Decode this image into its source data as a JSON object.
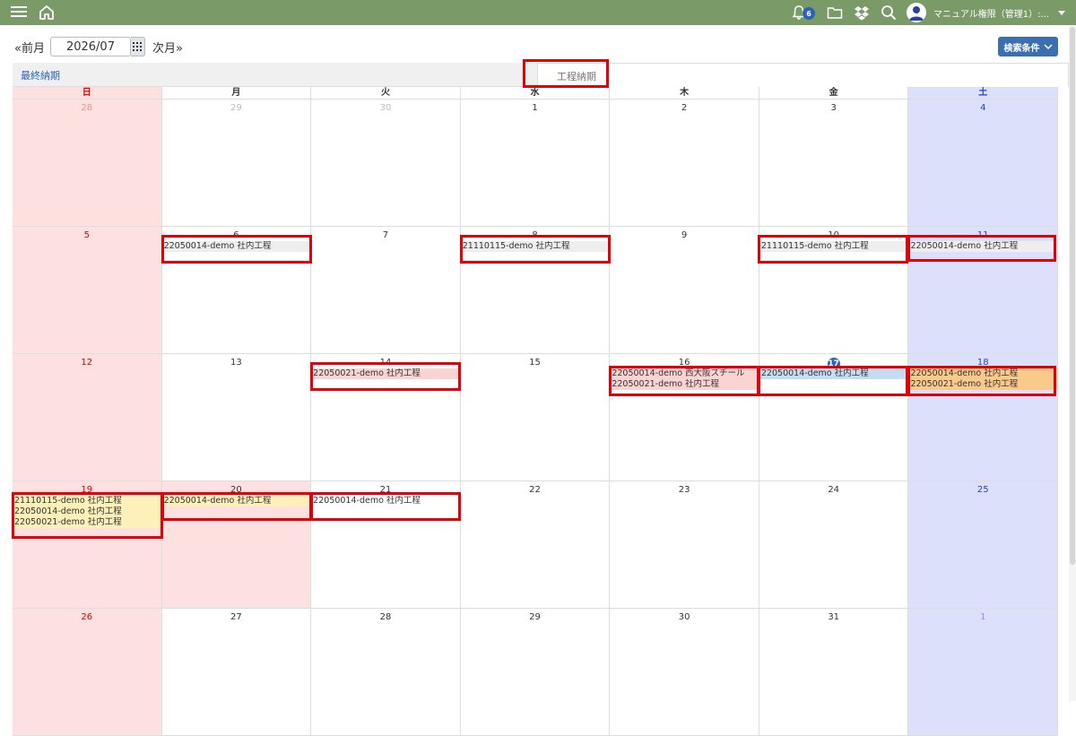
{
  "topbar": {
    "notification_count": "6",
    "user_name": "マニュアル権限（管理1）:...",
    "bar_color": "#7a9a68"
  },
  "nav": {
    "prev_label": "«前月",
    "month_value": "2026/07",
    "next_label": "次月»",
    "search_label": "検索条件"
  },
  "tabs": {
    "final_due": "最終納期",
    "process_due": "工程納期"
  },
  "weekdays": [
    "日",
    "月",
    "火",
    "水",
    "木",
    "金",
    "土"
  ],
  "weeks": [
    {
      "days": [
        {
          "num": "28",
          "other": true,
          "events": []
        },
        {
          "num": "29",
          "other": true,
          "events": []
        },
        {
          "num": "30",
          "other": true,
          "events": []
        },
        {
          "num": "1",
          "events": []
        },
        {
          "num": "2",
          "events": []
        },
        {
          "num": "3",
          "events": []
        },
        {
          "num": "4",
          "events": []
        }
      ]
    },
    {
      "days": [
        {
          "num": "5",
          "events": []
        },
        {
          "num": "6",
          "events": [
            {
              "text": "22050014-demo 社内工程",
              "color": "grey"
            }
          ]
        },
        {
          "num": "7",
          "events": []
        },
        {
          "num": "8",
          "events": [
            {
              "text": "21110115-demo 社内工程",
              "color": "grey"
            }
          ]
        },
        {
          "num": "9",
          "events": []
        },
        {
          "num": "10",
          "events": [
            {
              "text": "21110115-demo 社内工程",
              "color": "grey"
            }
          ]
        },
        {
          "num": "11",
          "events": [
            {
              "text": "22050014-demo 社内工程",
              "color": "grey"
            }
          ]
        }
      ]
    },
    {
      "days": [
        {
          "num": "12",
          "events": []
        },
        {
          "num": "13",
          "events": []
        },
        {
          "num": "14",
          "events": [
            {
              "text": "22050021-demo 社内工程",
              "color": "pink"
            }
          ]
        },
        {
          "num": "15",
          "events": []
        },
        {
          "num": "16",
          "events": [
            {
              "text": "22050014-demo 西大阪スチール",
              "color": "pink"
            },
            {
              "text": "22050021-demo 社内工程",
              "color": "pink"
            }
          ]
        },
        {
          "num": "17",
          "today": true,
          "events": [
            {
              "text": "22050014-demo 社内工程",
              "color": "blue"
            }
          ]
        },
        {
          "num": "18",
          "events": [
            {
              "text": "22050014-demo 社内工程",
              "color": "orange"
            },
            {
              "text": "22050021-demo 社内工程",
              "color": "orange"
            }
          ]
        }
      ]
    },
    {
      "days": [
        {
          "num": "19",
          "events": [
            {
              "text": "21110115-demo 社内工程",
              "color": "yellow"
            },
            {
              "text": "22050014-demo 社内工程",
              "color": "yellow"
            },
            {
              "text": "22050021-demo 社内工程",
              "color": "yellow"
            }
          ]
        },
        {
          "num": "20",
          "highlight": true,
          "events": [
            {
              "text": "22050014-demo 社内工程",
              "color": "yellow"
            }
          ]
        },
        {
          "num": "21",
          "events": [
            {
              "text": "22050014-demo 社内工程",
              "color": "white"
            }
          ]
        },
        {
          "num": "22",
          "events": []
        },
        {
          "num": "23",
          "events": []
        },
        {
          "num": "24",
          "events": []
        },
        {
          "num": "25",
          "events": []
        }
      ]
    },
    {
      "days": [
        {
          "num": "26",
          "events": []
        },
        {
          "num": "27",
          "events": []
        },
        {
          "num": "28",
          "events": []
        },
        {
          "num": "29",
          "events": []
        },
        {
          "num": "30",
          "events": []
        },
        {
          "num": "31",
          "events": []
        },
        {
          "num": "1",
          "other": true,
          "events": []
        }
      ]
    }
  ]
}
